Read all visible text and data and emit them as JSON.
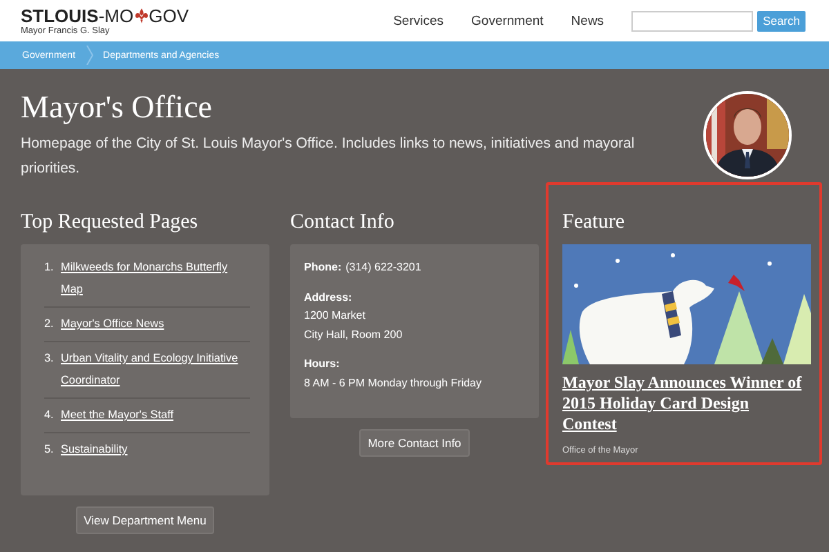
{
  "header": {
    "logo": {
      "main": "**STLOUIS**-MO",
      "end": "GOV"
    },
    "subtitle": "Mayor Francis G. Slay",
    "nav": [
      "Services",
      "Government",
      "News"
    ],
    "search": {
      "button": "Search"
    }
  },
  "breadcrumb": [
    "Government",
    "Departments and Agencies"
  ],
  "page": {
    "title": "Mayor's Office",
    "description": "Homepage of the City of St. Louis Mayor's Office. Includes links to news, initiatives and mayoral priorities."
  },
  "top_requested": {
    "heading": "Top Requested Pages",
    "items": [
      {
        "number": "1.",
        "label": "Milkweeds for Monarchs Butterfly Map"
      },
      {
        "number": "2.",
        "label": "Mayor's Office News"
      },
      {
        "number": "3.",
        "label": "Urban Vitality and Ecology Initiative Coordinator"
      },
      {
        "number": "4.",
        "label": "Meet the Mayor's Staff"
      },
      {
        "number": "5.",
        "label": "Sustainability"
      }
    ],
    "button": "View Department Menu"
  },
  "contact": {
    "heading": "Contact Info",
    "lines": [
      {
        "label": "Phone:",
        "value": "(314) 622-3201",
        "inline": true
      },
      {
        "label": "Address:",
        "value": "1200 Market\nCity Hall, Room 200",
        "inline": false
      },
      {
        "label": "Hours:",
        "value": "8 AM - 6 PM Monday through Friday",
        "inline": false
      }
    ],
    "button": "More Contact Info"
  },
  "feature": {
    "heading": "Feature",
    "highlighted": true,
    "title": "Mayor Slay Announces Winner of 2015 Holiday Card Design Contest",
    "source": "Office of the Mayor"
  }
}
